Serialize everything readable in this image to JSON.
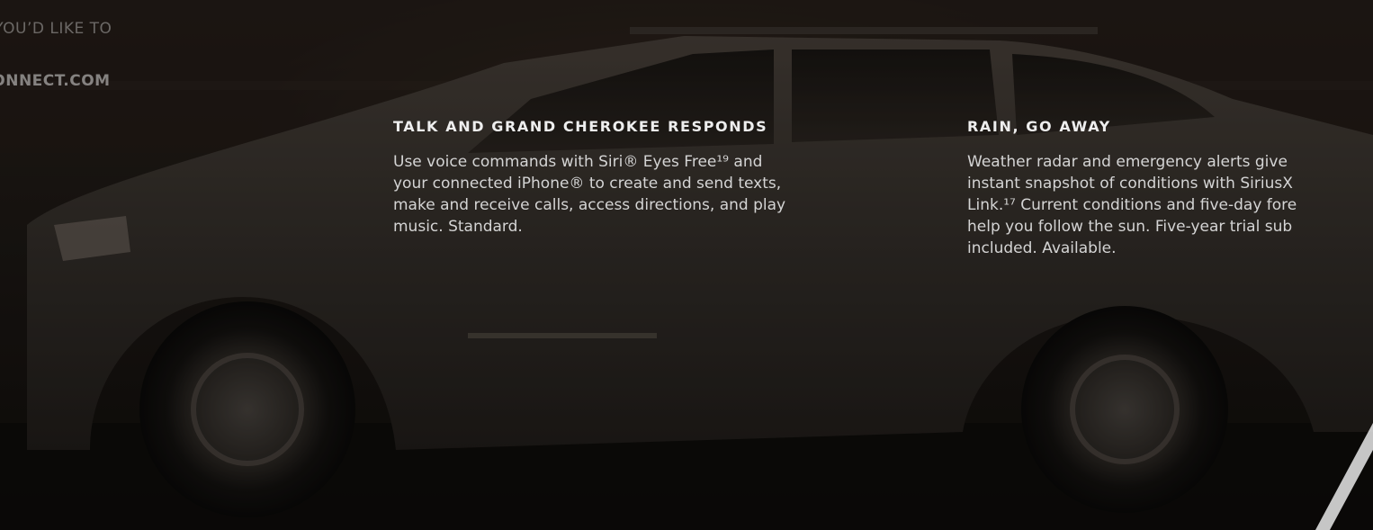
{
  "nav_fragments": {
    "top_line": "W YOU’D LIKE TO",
    "second_line": "UCONNECT.COM"
  },
  "features": [
    {
      "title": "TALK AND GRAND CHEROKEE RESPONDS",
      "lines": [
        "Use voice commands with Siri® Eyes Free¹⁹ and",
        "your connected iPhone® to create and send texts,",
        "make and receive calls, access directions, and play",
        "music. Standard."
      ]
    },
    {
      "title": "RAIN, GO AWAY",
      "lines": [
        "Weather radar and emergency alerts give",
        "instant snapshot of conditions with SiriusX",
        "Link.¹⁷ Current conditions and five-day fore",
        "help you follow the sun. Five-year trial sub",
        "included. Available."
      ]
    }
  ],
  "colors": {
    "background": "#1a1613",
    "text": "#d4d4d4",
    "heading": "#eeeeee",
    "accent_slash": "#e8e8e8"
  },
  "background_image": "dark-suv-side-profile"
}
